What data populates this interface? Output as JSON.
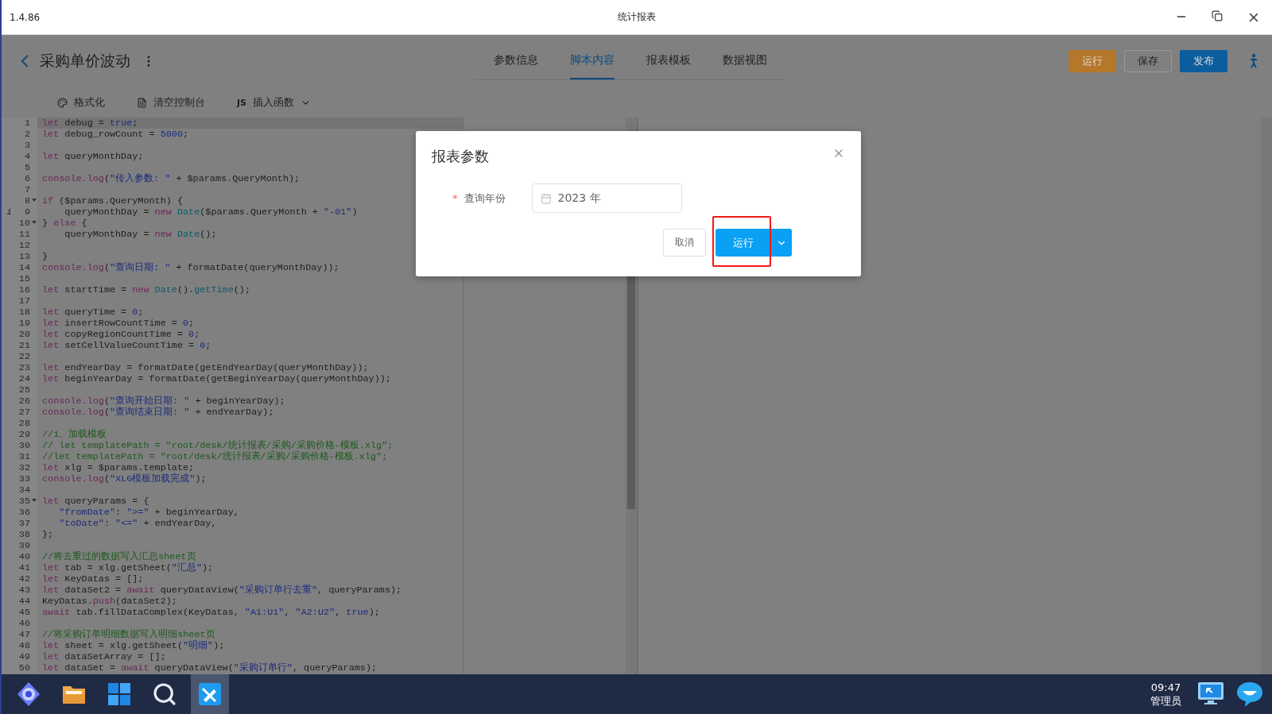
{
  "window": {
    "version": "1.4.86",
    "title": "统计报表"
  },
  "header": {
    "title": "采购单价波动",
    "tabs": [
      {
        "label": "参数信息",
        "selected": false
      },
      {
        "label": "脚本内容",
        "selected": true
      },
      {
        "label": "报表模板",
        "selected": false
      },
      {
        "label": "数据视图",
        "selected": false
      }
    ],
    "actions": [
      {
        "label": "运行",
        "kind": "warning"
      },
      {
        "label": "保存",
        "kind": "default"
      },
      {
        "label": "发布",
        "kind": "primary"
      }
    ]
  },
  "toolbar": [
    {
      "label": "格式化",
      "kind": "format"
    },
    {
      "label": "清空控制台",
      "kind": "clear"
    },
    {
      "label": "插入函数",
      "kind": "insert",
      "prefix": "JS"
    }
  ],
  "editor": {
    "lines": [
      {
        "number": "1",
        "active": true,
        "foldable": false,
        "tokens": [
          {
            "kind": "kw",
            "text": "let"
          },
          {
            "kind": "plain",
            "text": " debug = "
          },
          {
            "kind": "num",
            "text": "true"
          },
          {
            "kind": "plain",
            "text": ";"
          }
        ]
      },
      {
        "number": "2",
        "active": false,
        "foldable": false,
        "tokens": [
          {
            "kind": "kw",
            "text": "let"
          },
          {
            "kind": "plain",
            "text": " debug_rowCount = "
          },
          {
            "kind": "num",
            "text": "5000"
          },
          {
            "kind": "plain",
            "text": ";"
          }
        ]
      },
      {
        "number": "3",
        "active": false,
        "foldable": false
      },
      {
        "number": "4",
        "active": false,
        "foldable": false,
        "tokens": [
          {
            "kind": "kw",
            "text": "let"
          },
          {
            "kind": "plain",
            "text": " queryMonthDay;"
          }
        ]
      },
      {
        "number": "5",
        "active": false,
        "foldable": false
      },
      {
        "number": "6",
        "active": false,
        "foldable": false,
        "tokens": [
          {
            "kind": "kw",
            "text": "console.log"
          },
          {
            "kind": "plain",
            "text": "("
          },
          {
            "kind": "str",
            "text": "\"传入参数: \""
          },
          {
            "kind": "plain",
            "text": " + $params.QueryMonth);"
          }
        ]
      },
      {
        "number": "7",
        "active": false,
        "foldable": false
      },
      {
        "number": "8",
        "active": false,
        "foldable": true,
        "tokens": [
          {
            "kind": "kw",
            "text": "if"
          },
          {
            "kind": "plain",
            "text": " ($params.QueryMonth) {"
          }
        ]
      },
      {
        "number": "9",
        "active": false,
        "foldable": false,
        "marker": "i",
        "tokens": [
          {
            "kind": "plain",
            "text": "    queryMonthDay = "
          },
          {
            "kind": "kw",
            "text": "new "
          },
          {
            "kind": "type",
            "text": "Date"
          },
          {
            "kind": "plain",
            "text": "($params.QueryMonth + "
          },
          {
            "kind": "str",
            "text": "\"-01\""
          },
          {
            "kind": "plain",
            "text": ")"
          }
        ]
      },
      {
        "number": "10",
        "active": false,
        "foldable": true,
        "tokens": [
          {
            "kind": "plain",
            "text": "} "
          },
          {
            "kind": "kw",
            "text": "else"
          },
          {
            "kind": "plain",
            "text": " {"
          }
        ]
      },
      {
        "number": "11",
        "active": false,
        "foldable": false,
        "tokens": [
          {
            "kind": "plain",
            "text": "    queryMonthDay = "
          },
          {
            "kind": "kw",
            "text": "new "
          },
          {
            "kind": "type",
            "text": "Date"
          },
          {
            "kind": "plain",
            "text": "();"
          }
        ]
      },
      {
        "number": "12",
        "active": false,
        "foldable": false
      },
      {
        "number": "13",
        "active": false,
        "foldable": false,
        "tokens": [
          {
            "kind": "plain",
            "text": "}"
          }
        ]
      },
      {
        "number": "14",
        "active": false,
        "foldable": false,
        "tokens": [
          {
            "kind": "kw",
            "text": "console.log"
          },
          {
            "kind": "plain",
            "text": "("
          },
          {
            "kind": "str",
            "text": "\"查询日期: \""
          },
          {
            "kind": "plain",
            "text": " + formatDate(queryMonthDay));"
          }
        ]
      },
      {
        "number": "15",
        "active": false,
        "foldable": false
      },
      {
        "number": "16",
        "active": false,
        "foldable": false,
        "tokens": [
          {
            "kind": "kw",
            "text": "let"
          },
          {
            "kind": "plain",
            "text": " startTime = "
          },
          {
            "kind": "kw",
            "text": "new "
          },
          {
            "kind": "type",
            "text": "Date"
          },
          {
            "kind": "plain",
            "text": "()."
          },
          {
            "kind": "type",
            "text": "getTime"
          },
          {
            "kind": "plain",
            "text": "();"
          }
        ]
      },
      {
        "number": "17",
        "active": false,
        "foldable": false
      },
      {
        "number": "18",
        "active": false,
        "foldable": false,
        "tokens": [
          {
            "kind": "kw",
            "text": "let"
          },
          {
            "kind": "plain",
            "text": " queryTime = "
          },
          {
            "kind": "num",
            "text": "0"
          },
          {
            "kind": "plain",
            "text": ";"
          }
        ]
      },
      {
        "number": "19",
        "active": false,
        "foldable": false,
        "tokens": [
          {
            "kind": "kw",
            "text": "let"
          },
          {
            "kind": "plain",
            "text": " insertRowCountTime = "
          },
          {
            "kind": "num",
            "text": "0"
          },
          {
            "kind": "plain",
            "text": ";"
          }
        ]
      },
      {
        "number": "20",
        "active": false,
        "foldable": false,
        "tokens": [
          {
            "kind": "kw",
            "text": "let"
          },
          {
            "kind": "plain",
            "text": " copyRegionCountTime = "
          },
          {
            "kind": "num",
            "text": "0"
          },
          {
            "kind": "plain",
            "text": ";"
          }
        ]
      },
      {
        "number": "21",
        "active": false,
        "foldable": false,
        "tokens": [
          {
            "kind": "kw",
            "text": "let"
          },
          {
            "kind": "plain",
            "text": " setCellValueCountTime = "
          },
          {
            "kind": "num",
            "text": "0"
          },
          {
            "kind": "plain",
            "text": ";"
          }
        ]
      },
      {
        "number": "22",
        "active": false,
        "foldable": false
      },
      {
        "number": "23",
        "active": false,
        "foldable": false,
        "tokens": [
          {
            "kind": "kw",
            "text": "let"
          },
          {
            "kind": "plain",
            "text": " endYearDay = formatDate(getEndYearDay(queryMonthDay));"
          }
        ]
      },
      {
        "number": "24",
        "active": false,
        "foldable": false,
        "tokens": [
          {
            "kind": "kw",
            "text": "let"
          },
          {
            "kind": "plain",
            "text": " beginYearDay = formatDate(getBeginYearDay(queryMonthDay));"
          }
        ]
      },
      {
        "number": "25",
        "active": false,
        "foldable": false
      },
      {
        "number": "26",
        "active": false,
        "foldable": false,
        "tokens": [
          {
            "kind": "kw",
            "text": "console.log"
          },
          {
            "kind": "plain",
            "text": "("
          },
          {
            "kind": "str",
            "text": "\"查询开始日期: \""
          },
          {
            "kind": "plain",
            "text": " + beginYearDay);"
          }
        ]
      },
      {
        "number": "27",
        "active": false,
        "foldable": false,
        "tokens": [
          {
            "kind": "kw",
            "text": "console.log"
          },
          {
            "kind": "plain",
            "text": "("
          },
          {
            "kind": "str",
            "text": "\"查询结束日期: \""
          },
          {
            "kind": "plain",
            "text": " + endYearDay);"
          }
        ]
      },
      {
        "number": "28",
        "active": false,
        "foldable": false
      },
      {
        "number": "29",
        "active": false,
        "foldable": false,
        "tokens": [
          {
            "kind": "com",
            "text": "//1、加载模板"
          }
        ]
      },
      {
        "number": "30",
        "active": false,
        "foldable": false,
        "tokens": [
          {
            "kind": "com",
            "text": "// let templatePath = \"root/desk/统计报表/采购/采购价格-模板.xlg\";"
          }
        ]
      },
      {
        "number": "31",
        "active": false,
        "foldable": false,
        "tokens": [
          {
            "kind": "com",
            "text": "//let templatePath = \"root/desk/统计报表/采购/采购价格-模板.xlg\";"
          }
        ]
      },
      {
        "number": "32",
        "active": false,
        "foldable": false,
        "tokens": [
          {
            "kind": "kw",
            "text": "let"
          },
          {
            "kind": "plain",
            "text": " xlg = $params.template;"
          }
        ]
      },
      {
        "number": "33",
        "active": false,
        "foldable": false,
        "tokens": [
          {
            "kind": "kw",
            "text": "console.log"
          },
          {
            "kind": "plain",
            "text": "("
          },
          {
            "kind": "str",
            "text": "\"XLG模板加载完成\""
          },
          {
            "kind": "plain",
            "text": ");"
          }
        ]
      },
      {
        "number": "34",
        "active": false,
        "foldable": false
      },
      {
        "number": "35",
        "active": false,
        "foldable": true,
        "tokens": [
          {
            "kind": "kw",
            "text": "let"
          },
          {
            "kind": "plain",
            "text": " queryParams = {"
          }
        ]
      },
      {
        "number": "36",
        "active": false,
        "foldable": false,
        "tokens": [
          {
            "kind": "str",
            "text": "   \"fromDate\""
          },
          {
            "kind": "plain",
            "text": ": "
          },
          {
            "kind": "str",
            "text": "\">=\""
          },
          {
            "kind": "plain",
            "text": " + beginYearDay,"
          }
        ]
      },
      {
        "number": "37",
        "active": false,
        "foldable": false,
        "tokens": [
          {
            "kind": "str",
            "text": "   \"toDate\""
          },
          {
            "kind": "plain",
            "text": ": "
          },
          {
            "kind": "str",
            "text": "\"<=\""
          },
          {
            "kind": "plain",
            "text": " + endYearDay,"
          }
        ]
      },
      {
        "number": "38",
        "active": false,
        "foldable": false,
        "tokens": [
          {
            "kind": "plain",
            "text": "};"
          }
        ]
      },
      {
        "number": "39",
        "active": false,
        "foldable": false
      },
      {
        "number": "40",
        "active": false,
        "foldable": false,
        "tokens": [
          {
            "kind": "com",
            "text": "//将去重过的数据写入汇总sheet页"
          }
        ]
      },
      {
        "number": "41",
        "active": false,
        "foldable": false,
        "tokens": [
          {
            "kind": "kw",
            "text": "let"
          },
          {
            "kind": "plain",
            "text": " tab = xlg.getSheet("
          },
          {
            "kind": "str",
            "text": "\"汇总\""
          },
          {
            "kind": "plain",
            "text": ");"
          }
        ]
      },
      {
        "number": "42",
        "active": false,
        "foldable": false,
        "tokens": [
          {
            "kind": "kw",
            "text": "let"
          },
          {
            "kind": "plain",
            "text": " KeyDatas = [];"
          }
        ]
      },
      {
        "number": "43",
        "active": false,
        "foldable": false,
        "tokens": [
          {
            "kind": "kw",
            "text": "let"
          },
          {
            "kind": "plain",
            "text": " dataSet2 = "
          },
          {
            "kind": "kw",
            "text": "await"
          },
          {
            "kind": "plain",
            "text": " queryDataView("
          },
          {
            "kind": "str",
            "text": "\"采购订单行去重\""
          },
          {
            "kind": "plain",
            "text": ", queryParams);"
          }
        ]
      },
      {
        "number": "44",
        "active": false,
        "foldable": false,
        "tokens": [
          {
            "kind": "plain",
            "text": "KeyDatas."
          },
          {
            "kind": "kw",
            "text": "push"
          },
          {
            "kind": "plain",
            "text": "(dataSet2);"
          }
        ]
      },
      {
        "number": "45",
        "active": false,
        "foldable": false,
        "tokens": [
          {
            "kind": "kw",
            "text": "await"
          },
          {
            "kind": "plain",
            "text": " tab.fillDataComplex(KeyDatas, "
          },
          {
            "kind": "str",
            "text": "\"A1:U1\""
          },
          {
            "kind": "plain",
            "text": ", "
          },
          {
            "kind": "str",
            "text": "\"A2:U2\""
          },
          {
            "kind": "plain",
            "text": ", "
          },
          {
            "kind": "num",
            "text": "true"
          },
          {
            "kind": "plain",
            "text": ");"
          }
        ]
      },
      {
        "number": "46",
        "active": false,
        "foldable": false
      },
      {
        "number": "47",
        "active": false,
        "foldable": false,
        "tokens": [
          {
            "kind": "com",
            "text": "//将采购订单明细数据写入明细sheet页"
          }
        ]
      },
      {
        "number": "48",
        "active": false,
        "foldable": false,
        "tokens": [
          {
            "kind": "kw",
            "text": "let"
          },
          {
            "kind": "plain",
            "text": " sheet = xlg.getSheet("
          },
          {
            "kind": "str",
            "text": "\"明细\""
          },
          {
            "kind": "plain",
            "text": ");"
          }
        ]
      },
      {
        "number": "49",
        "active": false,
        "foldable": false,
        "tokens": [
          {
            "kind": "kw",
            "text": "let"
          },
          {
            "kind": "plain",
            "text": " dataSetArray = [];"
          }
        ]
      },
      {
        "number": "50",
        "active": false,
        "foldable": false,
        "tokens": [
          {
            "kind": "kw",
            "text": "let"
          },
          {
            "kind": "plain",
            "text": " dataSet = "
          },
          {
            "kind": "kw",
            "text": "await"
          },
          {
            "kind": "plain",
            "text": " queryDataView("
          },
          {
            "kind": "str",
            "text": "\"采购订单行\""
          },
          {
            "kind": "plain",
            "text": ", queryParams);"
          }
        ]
      }
    ]
  },
  "dialog": {
    "title": "报表参数",
    "fields": [
      {
        "marker": "*",
        "label": "查询年份",
        "value": "2023 年"
      }
    ],
    "buttons": [
      {
        "label": "取消",
        "kind": "default",
        "highlighted": false
      },
      {
        "label": "运行",
        "kind": "split",
        "highlighted": true
      }
    ]
  },
  "taskbar": {
    "apps": [
      {
        "kind": "launcher",
        "selected": false
      },
      {
        "kind": "files",
        "selected": false
      },
      {
        "kind": "windows",
        "selected": false
      },
      {
        "kind": "search",
        "selected": false
      },
      {
        "kind": "editor",
        "selected": true
      }
    ],
    "time": "09:47",
    "user": "管理员",
    "tray": [
      {
        "kind": "monitor"
      },
      {
        "kind": "chat"
      }
    ]
  }
}
